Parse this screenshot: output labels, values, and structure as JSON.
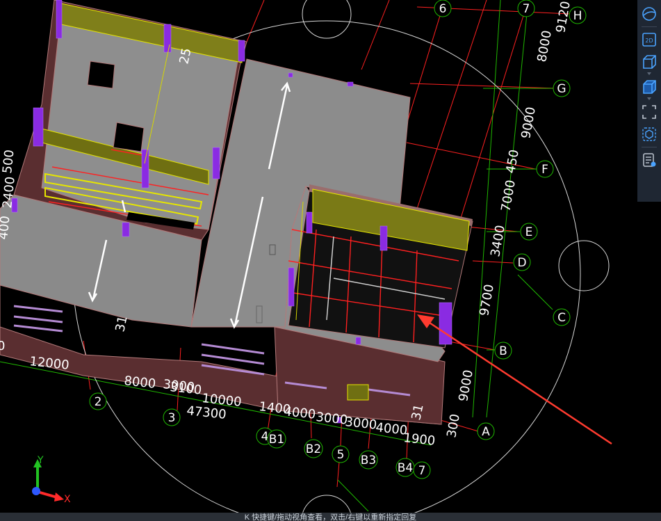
{
  "scene": {
    "dimensions": {
      "d_25": "25",
      "d_31_a": "31",
      "d_31_b": "31",
      "d_12000": "12000",
      "d_8000": "8000",
      "d_3000a": "3000",
      "d_3100": "3100",
      "d_10000": "10000",
      "d_47300": "47300",
      "d_1400": "1400",
      "d_4000a": "4000",
      "d_3000b": "3000",
      "d_3000c": "3000",
      "d_4000b": "4000",
      "d_1900": "1900",
      "d_300_bottom": "300",
      "d_9000_right": "9000",
      "d_9700": "9700",
      "d_3400": "3400",
      "d_7000": "7000",
      "d_450": "450",
      "d_9000_top": "9000",
      "d_8000_top": "8000",
      "d_9120": "9120",
      "d_left_0": "0",
      "d_left_500": "500",
      "d_left_400": "2400",
      "d_left_stack": "400"
    },
    "grid_bubbles": [
      "6",
      "7",
      "H",
      "G",
      "F",
      "E",
      "D",
      "C",
      "B",
      "A",
      "2",
      "3",
      "4",
      "B1",
      "B2",
      "5",
      "B3",
      "B4",
      "7"
    ]
  },
  "toolbar": {
    "items": [
      {
        "name": "orbit-icon"
      },
      {
        "name": "view-2d-icon",
        "label": "2D"
      },
      {
        "name": "wireframe-box-icon"
      },
      {
        "name": "solid-box-icon"
      },
      {
        "name": "fit-view-icon"
      },
      {
        "name": "select-box-icon"
      },
      {
        "name": "properties-panel-icon"
      }
    ]
  },
  "axes": {
    "x_label": "X",
    "y_label": "Y"
  },
  "status": {
    "text": "K 快捷键/拖动视角查看，双击/右键以重新指定回复"
  },
  "colors": {
    "grid_red": "#ff2020",
    "grid_green": "#1fb800",
    "wall_brown": "#6a3a3a",
    "floor_gray": "#8c8c8c",
    "column_purple": "#8a2be2",
    "beam_yellow": "#e6e600",
    "toolbar_bg": "#1f2733",
    "toolbar_icon": "#4aa3ff"
  }
}
